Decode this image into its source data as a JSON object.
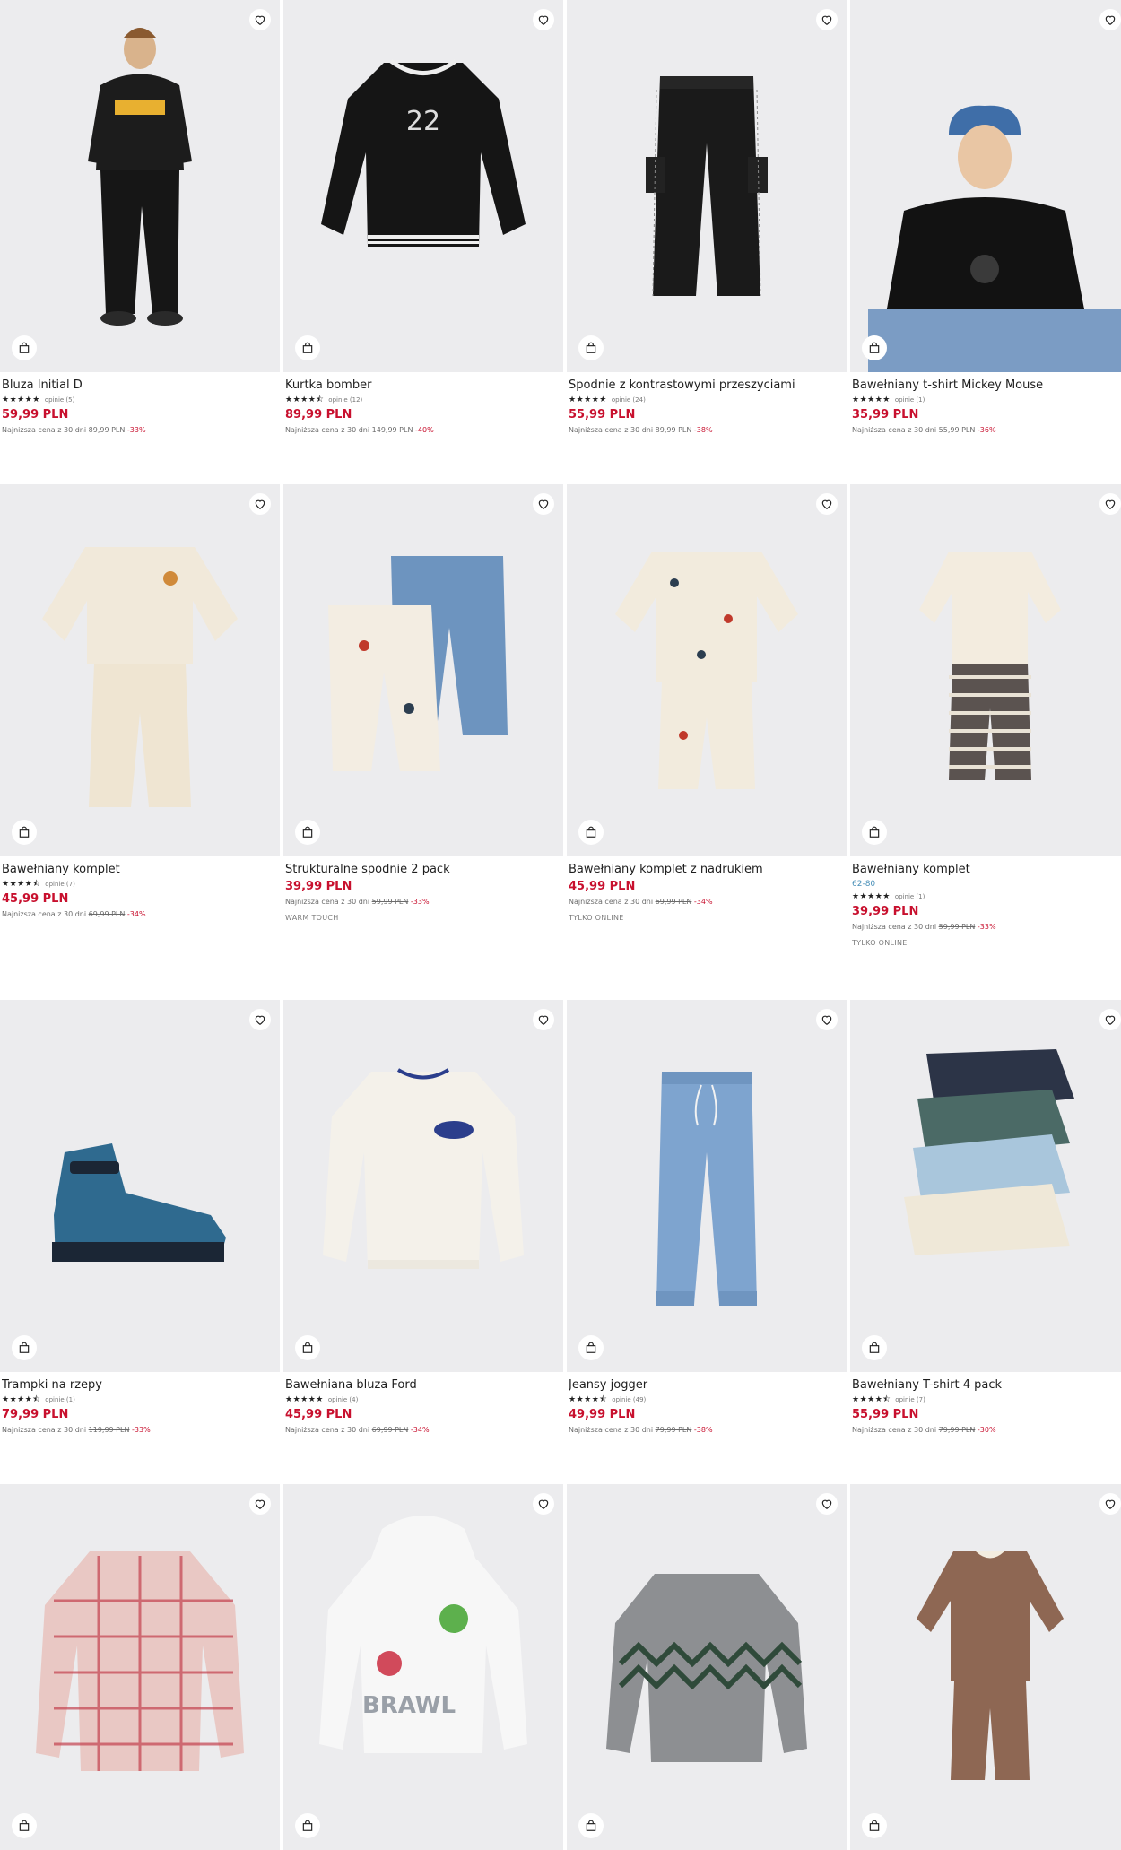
{
  "ui": {
    "accent": "#c8102e",
    "image_bg": "#ececee"
  },
  "products": [
    {
      "name": "Bluza Initial D",
      "stars": "★★★★★",
      "reviews": "opinie (5)",
      "price": "59,99 PLN",
      "lowest_label": "Najniższa cena z 30 dni",
      "old_price": "89,99 PLN",
      "discount": "-33%",
      "icon": "favorite-heart-icon"
    },
    {
      "name": "Kurtka bomber",
      "stars": "★★★★⯪",
      "reviews": "opinie (12)",
      "price": "89,99 PLN",
      "lowest_label": "Najniższa cena z 30 dni",
      "old_price": "149,99 PLN",
      "discount": "-40%"
    },
    {
      "name": "Spodnie z kontrastowymi przeszyciami",
      "stars": "★★★★★",
      "reviews": "opinie (24)",
      "price": "55,99 PLN",
      "lowest_label": "Najniższa cena z 30 dni",
      "old_price": "89,99 PLN",
      "discount": "-38%"
    },
    {
      "name": "Bawełniany t-shirt Mickey Mouse",
      "stars": "★★★★★",
      "reviews": "opinie (1)",
      "price": "35,99 PLN",
      "lowest_label": "Najniższa cena z 30 dni",
      "old_price": "55,99 PLN",
      "discount": "-36%"
    },
    {
      "name": "Bawełniany komplet",
      "stars": "★★★★⯪",
      "reviews": "opinie (7)",
      "price": "45,99 PLN",
      "lowest_label": "Najniższa cena z 30 dni",
      "old_price": "69,99 PLN",
      "discount": "-34%"
    },
    {
      "name": "Strukturalne spodnie 2 pack",
      "price": "39,99 PLN",
      "lowest_label": "Najniższa cena z 30 dni",
      "old_price": "59,99 PLN",
      "discount": "-33%",
      "tag": "WARM TOUCH"
    },
    {
      "name": "Bawełniany komplet z nadrukiem",
      "price": "45,99 PLN",
      "lowest_label": "Najniższa cena z 30 dni",
      "old_price": "69,99 PLN",
      "discount": "-34%",
      "tag": "TYLKO ONLINE"
    },
    {
      "name": "Bawełniany komplet",
      "sizes": "62-80",
      "stars": "★★★★★",
      "reviews": "opinie (1)",
      "price": "39,99 PLN",
      "lowest_label": "Najniższa cena z 30 dni",
      "old_price": "59,99 PLN",
      "discount": "-33%",
      "tag": "TYLKO ONLINE"
    },
    {
      "name": "Trampki na rzepy",
      "stars": "★★★★⯪",
      "reviews": "opinie (1)",
      "price": "79,99 PLN",
      "lowest_label": "Najniższa cena z 30 dni",
      "old_price": "119,99 PLN",
      "discount": "-33%"
    },
    {
      "name": "Bawełniana bluza Ford",
      "stars": "★★★★★",
      "reviews": "opinie (4)",
      "price": "45,99 PLN",
      "lowest_label": "Najniższa cena z 30 dni",
      "old_price": "69,99 PLN",
      "discount": "-34%"
    },
    {
      "name": "Jeansy jogger",
      "stars": "★★★★⯪",
      "reviews": "opinie (49)",
      "price": "49,99 PLN",
      "lowest_label": "Najniższa cena z 30 dni",
      "old_price": "79,99 PLN",
      "discount": "-38%"
    },
    {
      "name": "Bawełniany T-shirt 4 pack",
      "stars": "★★★★⯪",
      "reviews": "opinie (7)",
      "price": "55,99 PLN",
      "lowest_label": "Najniższa cena z 30 dni",
      "old_price": "79,99 PLN",
      "discount": "-30%"
    },
    {
      "name": "",
      "price": "",
      "lowest_label": ""
    },
    {
      "name": "",
      "price": "",
      "lowest_label": ""
    },
    {
      "name": "",
      "price": "",
      "lowest_label": ""
    },
    {
      "name": "",
      "price": "",
      "lowest_label": ""
    }
  ]
}
